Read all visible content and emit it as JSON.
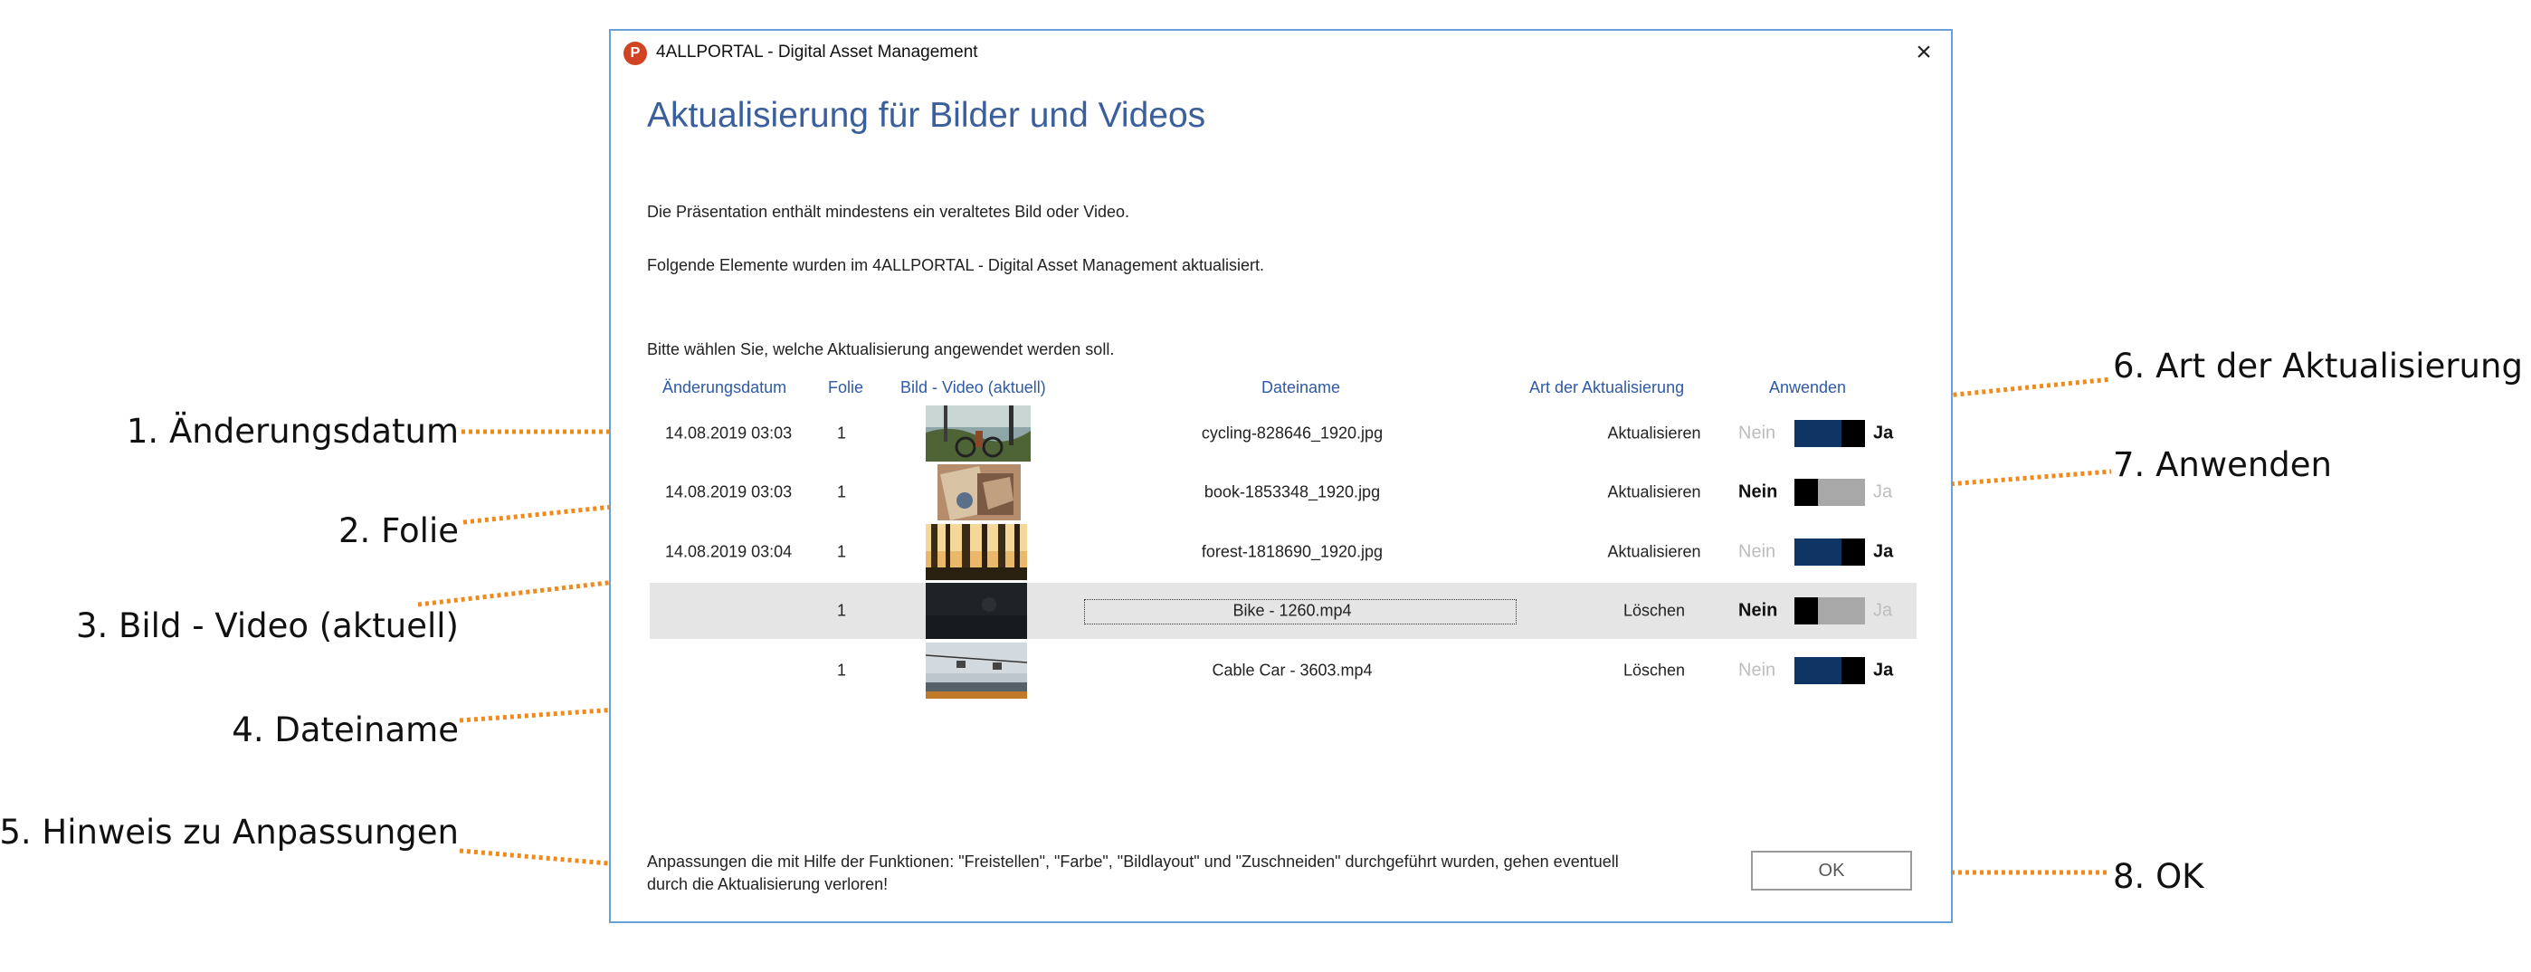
{
  "callouts": {
    "c1": "1. Änderungsdatum",
    "c2": "2. Folie",
    "c3": "3. Bild - Video (aktuell)",
    "c4": "4. Dateiname",
    "c5": "5. Hinweis zu Anpassungen",
    "c6": "6. Art der Aktualisierung",
    "c7": "7. Anwenden",
    "c8": "8. OK"
  },
  "colors": {
    "accent": "#3b5e9c",
    "callout_line": "#f08a1c",
    "toggle_on": "#0f3564"
  },
  "window": {
    "app_icon": "P",
    "title": "4ALLPORTAL - Digital Asset Management",
    "close": "×",
    "heading": "Aktualisierung für Bilder und Videos"
  },
  "intro": {
    "line1": "Die Präsentation enthält mindestens ein veraltetes Bild oder Video.",
    "line2": "Folgende Elemente wurden im 4ALLPORTAL - Digital Asset Management aktualisiert.",
    "line3": "Bitte wählen Sie, welche Aktualisierung angewendet werden soll."
  },
  "table": {
    "headers": {
      "date": "Änderungsdatum",
      "slide": "Folie",
      "media": "Bild - Video (aktuell)",
      "filename": "Dateiname",
      "update_type": "Art der Aktualisierung",
      "apply": "Anwenden"
    },
    "rows": [
      {
        "date": "14.08.2019 03:03",
        "slide": "1",
        "thumb": "cycling-thumbnail",
        "filename": "cycling-828646_1920.jpg",
        "update_type": "Aktualisieren",
        "no": "Nein",
        "yes": "Ja",
        "applied": true
      },
      {
        "date": "14.08.2019 03:03",
        "slide": "1",
        "thumb": "book-thumbnail",
        "filename": "book-1853348_1920.jpg",
        "update_type": "Aktualisieren",
        "no": "Nein",
        "yes": "Ja",
        "applied": false
      },
      {
        "date": "14.08.2019 03:04",
        "slide": "1",
        "thumb": "forest-thumbnail",
        "filename": "forest-1818690_1920.jpg",
        "update_type": "Aktualisieren",
        "no": "Nein",
        "yes": "Ja",
        "applied": true
      },
      {
        "date": "",
        "slide": "1",
        "thumb": "video-dark-thumbnail",
        "filename": "Bike - 1260.mp4",
        "update_type": "Löschen",
        "no": "Nein",
        "yes": "Ja",
        "applied": false
      },
      {
        "date": "",
        "slide": "1",
        "thumb": "cable-car-thumbnail",
        "filename": "Cable Car - 3603.mp4",
        "update_type": "Löschen",
        "no": "Nein",
        "yes": "Ja",
        "applied": true
      }
    ]
  },
  "footer": {
    "note_line1": "Anpassungen die mit Hilfe der Funktionen: \"Freistellen\", \"Farbe\", \"Bildlayout\" und \"Zuschneiden\" durchgeführt wurden, gehen eventuell",
    "note_line2": "durch die Aktualisierung verloren!",
    "ok": "OK"
  }
}
